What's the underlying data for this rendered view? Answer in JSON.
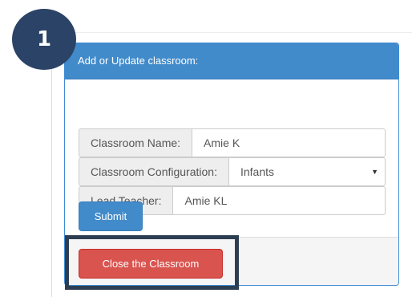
{
  "step": {
    "number": "1"
  },
  "panel": {
    "heading": "Add or Update classroom:"
  },
  "fields": {
    "classroom_name": {
      "label": "Classroom Name:",
      "value": "Amie K"
    },
    "classroom_configuration": {
      "label": "Classroom Configuration:",
      "value": "Infants"
    },
    "lead_teacher": {
      "label": "Lead Teacher:",
      "value": "Amie KL"
    }
  },
  "buttons": {
    "submit": "Submit",
    "close_classroom": "Close the Classroom"
  },
  "icons": {
    "select_caret": "chevron-down-icon"
  },
  "colors": {
    "badge": "#2b4366",
    "panel_primary": "#428bca",
    "danger": "#d9534f",
    "highlight_border": "#2e3e52"
  }
}
